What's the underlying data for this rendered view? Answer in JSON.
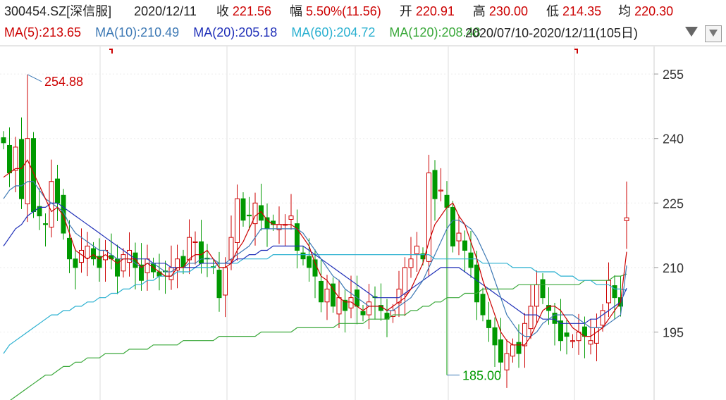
{
  "header": {
    "code": "300454.SZ[深信服]",
    "date": "2020/12/11",
    "close_label": "收",
    "close": "221.56",
    "change_label": "幅",
    "change": "5.50%(11.56)",
    "open_label": "开",
    "open": "220.91",
    "high_label": "高",
    "high": "230.00",
    "low_label": "低",
    "low": "214.35",
    "avg_label": "均",
    "avg": "220.30"
  },
  "ma_legend": [
    {
      "label": "MA(5):213.65",
      "color": "#cc0000"
    },
    {
      "label": "MA(10):210.49",
      "color": "#3c78b4"
    },
    {
      "label": "MA(20):205.18",
      "color": "#1f2fb8"
    },
    {
      "label": "MA(60):204.72",
      "color": "#2ab0d0"
    },
    {
      "label": "MA(120):208.48",
      "color": "#3aa83a"
    }
  ],
  "range": "2020/07/10-2020/12/11(105日)",
  "colors": {
    "up": "#cc0000",
    "down": "#009900",
    "grid": "#dddddd",
    "axis_text": "#333333"
  },
  "chart_data": {
    "type": "candlestick",
    "title": "",
    "y_ticks": [
      255,
      240,
      225,
      210,
      195
    ],
    "ylim": [
      179.2,
      261.4
    ],
    "max_label": "254.88",
    "min_label": "185.00",
    "closes": [
      239,
      232,
      238,
      226,
      240,
      223,
      222,
      220,
      230,
      225,
      218,
      212,
      210,
      214,
      215,
      212,
      210,
      214,
      212,
      208,
      213,
      214,
      210,
      207,
      212,
      209,
      208,
      209,
      210,
      212,
      210,
      217,
      216,
      211,
      212,
      210,
      203,
      210,
      217,
      226,
      221,
      222,
      225,
      221,
      219,
      220,
      220,
      220,
      222,
      214,
      212,
      210,
      208,
      202,
      205,
      201,
      203,
      200,
      203,
      201,
      199,
      202,
      203,
      200,
      198,
      200,
      205,
      210,
      212,
      215,
      212,
      232,
      226,
      228,
      224,
      215,
      218,
      214,
      210,
      202,
      199,
      196,
      192,
      188,
      190,
      192,
      190,
      197,
      201,
      206,
      203,
      200,
      197,
      193,
      194,
      193,
      195,
      194,
      193,
      196,
      200,
      207,
      203,
      201,
      221.56
    ],
    "ma5": [
      231,
      232,
      233,
      233,
      235,
      232,
      229,
      226,
      223,
      224,
      222,
      218,
      214,
      213,
      212,
      213,
      212,
      213,
      212,
      211,
      212,
      212,
      212,
      210,
      211,
      210,
      209,
      208,
      208,
      210,
      210,
      212,
      213,
      213,
      214,
      212,
      210,
      210,
      211,
      214,
      216,
      219,
      222,
      223,
      221,
      220,
      220,
      220,
      220,
      219,
      217,
      215,
      211,
      208,
      207,
      205,
      203,
      202,
      202,
      201,
      200,
      201,
      201,
      201,
      200,
      201,
      202,
      203,
      205,
      208,
      211,
      216,
      220,
      222,
      224,
      225,
      222,
      220,
      216,
      212,
      207,
      203,
      199,
      195,
      193,
      192,
      192,
      192,
      194,
      197,
      200,
      201,
      201,
      200,
      198,
      196,
      195,
      194,
      194,
      195,
      196,
      198,
      200,
      202,
      213.65
    ],
    "ma10": [
      226,
      228,
      229,
      229,
      230,
      230,
      228,
      226,
      225,
      224,
      223,
      220,
      218,
      217,
      216,
      215,
      214,
      214,
      213,
      212,
      212,
      212,
      211,
      210,
      211,
      211,
      210,
      209,
      209,
      210,
      210,
      211,
      211,
      212,
      212,
      212,
      211,
      211,
      212,
      213,
      214,
      215,
      217,
      219,
      219,
      219,
      219,
      219,
      219,
      219,
      218,
      216,
      214,
      212,
      210,
      208,
      207,
      205,
      204,
      203,
      202,
      201,
      201,
      201,
      200,
      200,
      201,
      202,
      203,
      205,
      207,
      210,
      213,
      216,
      219,
      221,
      221,
      220,
      219,
      217,
      214,
      211,
      207,
      203,
      199,
      197,
      195,
      194,
      194,
      195,
      197,
      198,
      199,
      199,
      199,
      199,
      198,
      197,
      196,
      196,
      196,
      197,
      198,
      199,
      210.49
    ],
    "ma20": [
      215,
      217,
      219,
      220,
      222,
      223,
      224,
      224,
      225,
      225,
      224,
      223,
      222,
      221,
      220,
      219,
      218,
      217,
      216,
      215,
      214,
      213,
      212,
      212,
      212,
      211,
      211,
      211,
      210,
      210,
      210,
      210,
      210,
      211,
      211,
      211,
      211,
      211,
      211,
      212,
      212,
      213,
      213,
      214,
      214,
      215,
      215,
      215,
      215,
      215,
      215,
      214,
      213,
      212,
      211,
      210,
      209,
      208,
      207,
      206,
      205,
      204,
      203,
      203,
      203,
      203,
      203,
      204,
      205,
      206,
      207,
      208,
      209,
      210,
      210,
      210,
      210,
      209,
      208,
      207,
      206,
      205,
      204,
      203,
      202,
      201,
      200,
      199,
      199,
      199,
      198,
      198,
      198,
      197,
      197,
      197,
      197,
      197,
      198,
      198,
      199,
      200,
      201,
      202,
      205.18
    ],
    "ma60": [
      190,
      192,
      193,
      194,
      195,
      196,
      197,
      198,
      199,
      199,
      200,
      200,
      201,
      201,
      202,
      202,
      203,
      203,
      204,
      204,
      205,
      205,
      206,
      206,
      207,
      207,
      208,
      208,
      208,
      209,
      209,
      209,
      210,
      210,
      210,
      210,
      211,
      211,
      211,
      211,
      212,
      212,
      212,
      212,
      212,
      213,
      213,
      213,
      213,
      213,
      213,
      213,
      213,
      213,
      213,
      213,
      213,
      213,
      213,
      213,
      213,
      213,
      213,
      213,
      213,
      213,
      213,
      213,
      213,
      213,
      213,
      213,
      212,
      212,
      212,
      212,
      212,
      212,
      212,
      212,
      211,
      211,
      211,
      211,
      211,
      210,
      210,
      210,
      210,
      209,
      209,
      209,
      209,
      208,
      208,
      208,
      207,
      207,
      207,
      206,
      206,
      206,
      205,
      205,
      204.72
    ],
    "ma120": [
      178,
      179,
      180,
      181,
      182,
      183,
      184,
      185,
      185,
      186,
      187,
      187,
      188,
      188,
      189,
      189,
      189,
      190,
      190,
      190,
      190,
      191,
      191,
      191,
      191,
      192,
      192,
      192,
      192,
      192,
      193,
      193,
      193,
      193,
      193,
      193,
      194,
      194,
      194,
      194,
      194,
      194,
      194,
      195,
      195,
      195,
      195,
      195,
      195,
      196,
      196,
      196,
      196,
      196,
      196,
      196,
      197,
      197,
      197,
      197,
      197,
      198,
      198,
      198,
      198,
      199,
      199,
      199,
      200,
      200,
      201,
      201,
      202,
      202,
      203,
      203,
      203,
      204,
      204,
      204,
      205,
      205,
      205,
      205,
      205,
      205,
      206,
      206,
      206,
      206,
      206,
      206,
      206,
      206,
      206,
      206,
      206,
      207,
      207,
      207,
      207,
      207,
      208,
      208,
      208.48
    ]
  }
}
